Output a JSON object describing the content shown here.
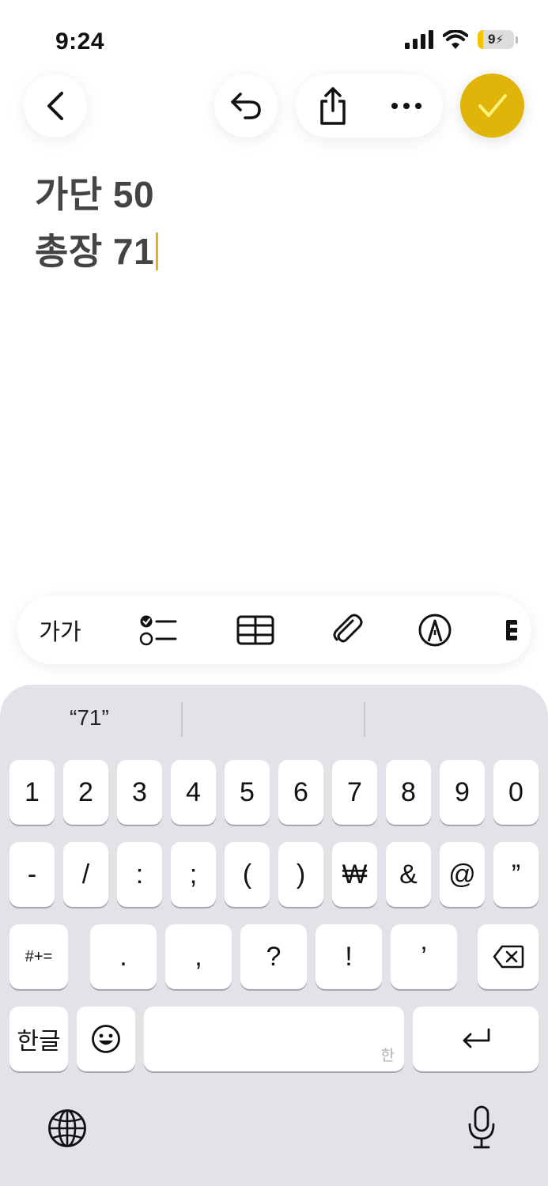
{
  "status_bar": {
    "time": "9:24",
    "battery": "9"
  },
  "note": {
    "lines": [
      "가단 50",
      "총장 71"
    ]
  },
  "format_bar": {
    "text_style_label": "가가"
  },
  "keyboard": {
    "suggestion": "“71”",
    "row1": [
      "1",
      "2",
      "3",
      "4",
      "5",
      "6",
      "7",
      "8",
      "9",
      "0"
    ],
    "row2": [
      "-",
      "/",
      ":",
      ";",
      "(",
      ")",
      "₩",
      "&",
      "@",
      "”"
    ],
    "row3": [
      "#+=",
      ".",
      ",",
      "?",
      "!",
      "’"
    ],
    "hangul_label": "한글",
    "space_hint": "한"
  },
  "colors": {
    "accent": "#e1b40a",
    "keyboard_bg": "#e2e3e8"
  }
}
